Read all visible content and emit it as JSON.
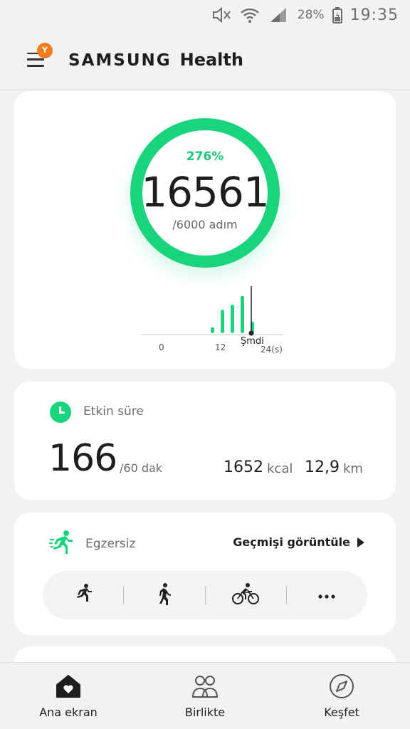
{
  "status_bar": {
    "battery_percent": "28%",
    "time": "19:35",
    "icons": [
      "mute-icon",
      "wifi-icon",
      "signal-icon",
      "battery-icon"
    ]
  },
  "header": {
    "badge": "Y",
    "brand_samsung": "SAMSUNG",
    "brand_health": "Health"
  },
  "steps": {
    "percent": "276%",
    "count": "16561",
    "goal": "/6000 adım",
    "progress_fraction": 1.0,
    "chart": {
      "tick_start": "0",
      "tick_mid": "12",
      "tick_now": "Şmdi",
      "tick_end": "24(s)",
      "bars_relative": [
        0.14,
        0.55,
        0.67,
        0.87,
        0.27
      ]
    },
    "accent_color": "#19d37d"
  },
  "active_time": {
    "label": "Etkin süre",
    "value": "166",
    "goal": "/60 dak",
    "kcal_value": "1652",
    "kcal_unit": "kcal",
    "distance_value": "12,9",
    "distance_unit": "km"
  },
  "exercise": {
    "label": "Egzersiz",
    "history_label": "Geçmişi görüntüle",
    "activities": [
      "running-icon",
      "walking-icon",
      "cycling-icon",
      "more-icon"
    ]
  },
  "bottom_nav": {
    "items": [
      {
        "label": "Ana ekran",
        "icon": "home-heart-icon"
      },
      {
        "label": "Birlikte",
        "icon": "people-icon"
      },
      {
        "label": "Keşfet",
        "icon": "compass-icon"
      }
    ]
  }
}
